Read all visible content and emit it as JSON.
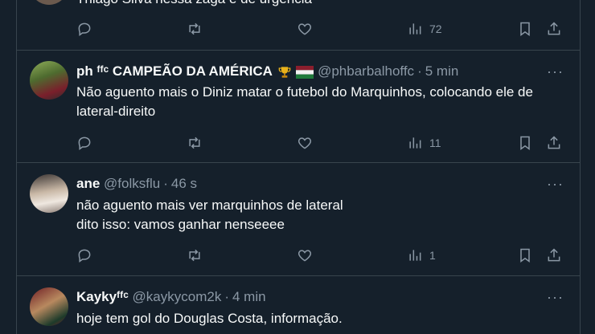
{
  "tweets": [
    {
      "text": "Thiago Silva nessa zaga é de urgência",
      "views": "72"
    },
    {
      "name": "ph ᶠᶠᶜ CAMPEÃO DA AMÉRICA",
      "handle": "@phbarbalhoffc",
      "time": "5 min",
      "text": "Não aguento mais o Diniz matar o futebol do Marquinhos, colocando ele de lateral-direito",
      "views": "11"
    },
    {
      "name": "ane",
      "handle": "@folksflu",
      "time": "46 s",
      "text_lines": [
        "não aguento mais ver marquinhos de lateral",
        "dito isso: vamos ganhar nenseeee"
      ],
      "views": "1"
    },
    {
      "name": "Kaykyᶠᶠᶜ",
      "handle": "@kaykycom2k",
      "time": "4 min",
      "text": "hoje tem gol do Douglas Costa, informação."
    }
  ],
  "more_glyph": "···",
  "colors": {
    "background": "#15202b",
    "secondary_text": "#8b98a5",
    "divider": "#38444d"
  },
  "icons": [
    "reply-icon",
    "retweet-icon",
    "like-icon",
    "views-icon",
    "bookmark-icon",
    "share-icon",
    "trophy-icon",
    "flag-icon"
  ]
}
